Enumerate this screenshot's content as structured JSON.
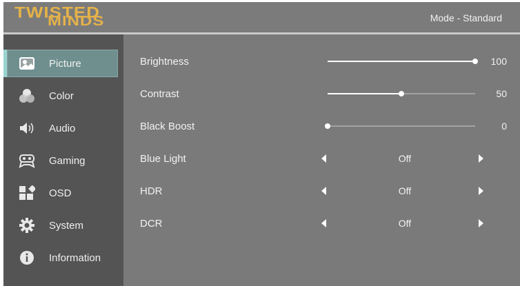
{
  "header": {
    "logo_line1": "TWISTED",
    "logo_line2": "MINDS",
    "mode": "Mode - Standard"
  },
  "sidebar": {
    "items": [
      {
        "label": "Picture",
        "icon": "picture-icon",
        "active": true
      },
      {
        "label": "Color",
        "icon": "color-icon"
      },
      {
        "label": "Audio",
        "icon": "audio-icon"
      },
      {
        "label": "Gaming",
        "icon": "gamepad-icon"
      },
      {
        "label": "OSD",
        "icon": "osd-icon"
      },
      {
        "label": "System",
        "icon": "gear-icon"
      },
      {
        "label": "Information",
        "icon": "info-icon"
      }
    ]
  },
  "settings": [
    {
      "name": "Brightness",
      "type": "slider",
      "value": "100",
      "fraction": 1.0
    },
    {
      "name": "Contrast",
      "type": "slider",
      "value": "50",
      "fraction": 0.5
    },
    {
      "name": "Black Boost",
      "type": "slider",
      "value": "0",
      "fraction": 0.0
    },
    {
      "name": "Blue Light",
      "type": "option",
      "value": "Off"
    },
    {
      "name": "HDR",
      "type": "option",
      "value": "Off"
    },
    {
      "name": "DCR",
      "type": "option",
      "value": "Off"
    }
  ],
  "colors": {
    "accent": "#9ad4d0",
    "logo": "#e4b24a",
    "background": "#7a7a7a",
    "sidebar": "#545454"
  }
}
